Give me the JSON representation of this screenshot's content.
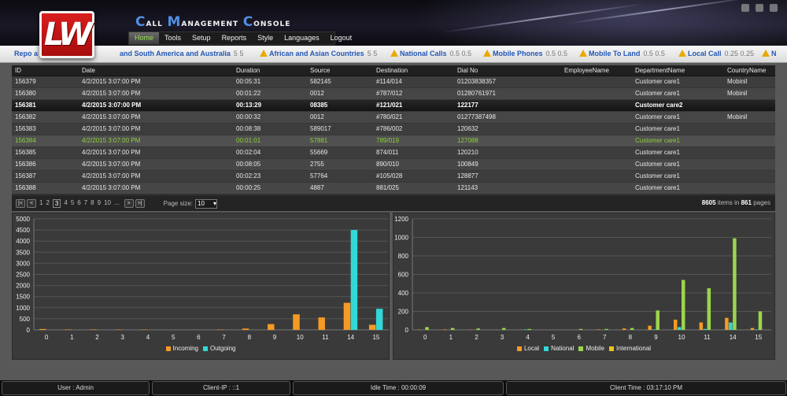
{
  "header": {
    "logo_text": "LW",
    "title_parts": [
      {
        "cap": "C",
        "rest": "all "
      },
      {
        "cap": "M",
        "rest": "anagement "
      },
      {
        "cap": "C",
        "rest": "onsole"
      }
    ],
    "menu": [
      "Home",
      "Tools",
      "Setup",
      "Reports",
      "Style",
      "Languages",
      "Logout"
    ],
    "active_menu": "Home"
  },
  "ticker": [
    {
      "label": "Repo a",
      "nums": "",
      "warn": false
    },
    {
      "label": "and South America and Australia",
      "nums": "5 5",
      "warn": false
    },
    {
      "label": "African and Asian Countries",
      "nums": "5 5",
      "warn": true
    },
    {
      "label": "National Calls",
      "nums": "0.5 0.5",
      "warn": true
    },
    {
      "label": "Mobile Phones",
      "nums": "0.5 0.5",
      "warn": true
    },
    {
      "label": "Mobile To Land",
      "nums": "0.5 0.5",
      "warn": true
    },
    {
      "label": "Local Call",
      "nums": "0.25 0.25",
      "warn": true
    },
    {
      "label": "N",
      "nums": "",
      "warn": true
    }
  ],
  "grid": {
    "columns": [
      "ID",
      "Date",
      "Duration",
      "Source",
      "Destination",
      "Dial No",
      "EmployeeName",
      "DepartmentName",
      "CountryName"
    ],
    "rows": [
      {
        "style": "odd",
        "cells": [
          "156379",
          "4/2/2015 3:07:00 PM",
          "00:05:31",
          "582145",
          "#114/014",
          "01203838357",
          "",
          "Customer care1",
          "Mobinil"
        ]
      },
      {
        "style": "even",
        "cells": [
          "156380",
          "4/2/2015 3:07:00 PM",
          "00:01:22",
          "0012",
          "#787/012",
          "01280761971",
          "",
          "Customer care1",
          "Mobinil"
        ]
      },
      {
        "style": "bold",
        "cells": [
          "156381",
          "4/2/2015 3:07:00 PM",
          "00:13:29",
          "08385",
          "#121/021",
          "122177",
          "",
          "Customer care2",
          ""
        ]
      },
      {
        "style": "even",
        "cells": [
          "156382",
          "4/2/2015 3:07:00 PM",
          "00:00:32",
          "0012",
          "#780/021",
          "01277387498",
          "",
          "Customer care1",
          "Mobinil"
        ]
      },
      {
        "style": "odd",
        "cells": [
          "156383",
          "4/2/2015 3:07:00 PM",
          "00:08:38",
          "589017",
          "#786/002",
          "120632",
          "",
          "Customer care1",
          ""
        ]
      },
      {
        "style": "hl",
        "cells": [
          "156384",
          "4/2/2015 3:07:00 PM",
          "00:01:01",
          "57881",
          "789/019",
          "127088",
          "",
          "Customer care1",
          ""
        ]
      },
      {
        "style": "odd",
        "cells": [
          "156385",
          "4/2/2015 3:07:00 PM",
          "00:02:04",
          "55669",
          "874/011",
          "120210",
          "",
          "Customer care1",
          ""
        ]
      },
      {
        "style": "even",
        "cells": [
          "156386",
          "4/2/2015 3:07:00 PM",
          "00:08:05",
          "2755",
          "890/010",
          "100849",
          "",
          "Customer care1",
          ""
        ]
      },
      {
        "style": "odd",
        "cells": [
          "156387",
          "4/2/2015 3:07:00 PM",
          "00:02:23",
          "57764",
          "#105/028",
          "128877",
          "",
          "Customer care1",
          ""
        ]
      },
      {
        "style": "even",
        "cells": [
          "156388",
          "4/2/2015 3:07:00 PM",
          "00:00:25",
          "4887",
          "881/025",
          "121143",
          "",
          "Customer care1",
          ""
        ]
      }
    ]
  },
  "pager": {
    "first": "|<",
    "prev": "<",
    "next": ">",
    "last": ">|",
    "pages": [
      "1",
      "2",
      "3",
      "4",
      "5",
      "6",
      "7",
      "8",
      "9",
      "10",
      "..."
    ],
    "current_page": "3",
    "page_size_label": "Page size:",
    "page_size": "10",
    "total_items": "8605",
    "items_in": "items in",
    "total_pages": "861",
    "pages_word": "pages"
  },
  "chart_data": [
    {
      "type": "bar",
      "categories": [
        "0",
        "1",
        "2",
        "3",
        "4",
        "5",
        "6",
        "7",
        "8",
        "9",
        "10",
        "11",
        "14",
        "15"
      ],
      "ylim": [
        0,
        5000
      ],
      "yticks": [
        "0",
        "500",
        "1000",
        "1500",
        "2000",
        "2500",
        "3000",
        "3500",
        "4000",
        "4500",
        "5000"
      ],
      "series": [
        {
          "name": "Incoming",
          "color": "#f59a23",
          "values": [
            40,
            20,
            20,
            15,
            15,
            0,
            0,
            15,
            60,
            260,
            700,
            560,
            1220,
            230
          ]
        },
        {
          "name": "Outgoing",
          "color": "#33d7d7",
          "values": [
            0,
            0,
            0,
            0,
            0,
            0,
            0,
            0,
            0,
            0,
            0,
            0,
            4500,
            950
          ]
        }
      ]
    },
    {
      "type": "bar",
      "categories": [
        "0",
        "1",
        "2",
        "3",
        "4",
        "5",
        "6",
        "7",
        "8",
        "9",
        "10",
        "11",
        "14",
        "15"
      ],
      "ylim": [
        0,
        1200
      ],
      "yticks": [
        "0",
        "200",
        "400",
        "600",
        "800",
        "1000",
        "1200"
      ],
      "series": [
        {
          "name": "Local",
          "color": "#f59a23",
          "values": [
            3,
            5,
            2,
            2,
            2,
            0,
            0,
            5,
            15,
            45,
            110,
            80,
            130,
            20
          ]
        },
        {
          "name": "National",
          "color": "#33d7d7",
          "values": [
            0,
            0,
            0,
            0,
            5,
            0,
            0,
            0,
            0,
            5,
            30,
            10,
            80,
            5
          ]
        },
        {
          "name": "Mobile",
          "color": "#9ad64b",
          "values": [
            30,
            20,
            15,
            20,
            10,
            0,
            10,
            10,
            20,
            210,
            540,
            450,
            990,
            200
          ]
        },
        {
          "name": "International",
          "color": "#f2c21a",
          "values": [
            0,
            0,
            0,
            0,
            0,
            0,
            0,
            0,
            0,
            0,
            0,
            0,
            0,
            0
          ]
        }
      ]
    }
  ],
  "status": {
    "user": "User : Admin",
    "client_ip": "Client-IP : ::1",
    "idle": "Idle Time : 00:00:09",
    "client_time": "Client Time : 03:17:10 PM"
  }
}
